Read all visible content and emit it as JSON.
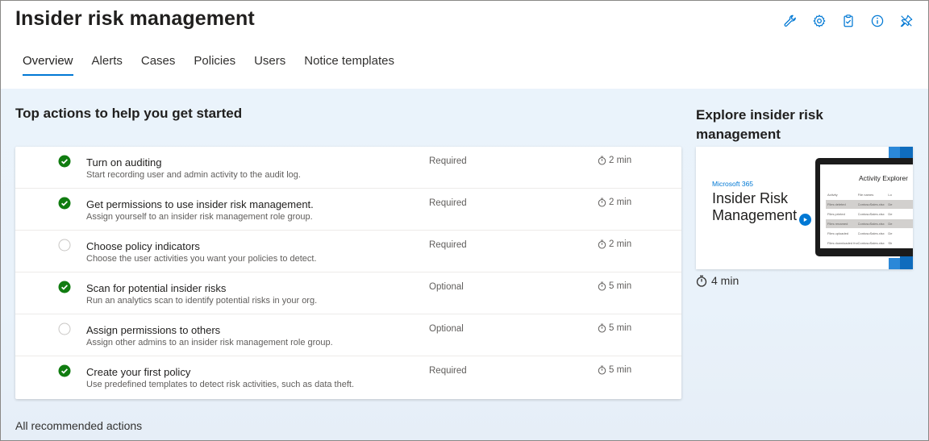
{
  "header": {
    "title": "Insider risk management",
    "icons": [
      "wrench-icon",
      "gear-icon",
      "clipboard-icon",
      "info-icon",
      "pin-icon"
    ]
  },
  "tabs": [
    {
      "label": "Overview",
      "active": true
    },
    {
      "label": "Alerts"
    },
    {
      "label": "Cases"
    },
    {
      "label": "Policies"
    },
    {
      "label": "Users"
    },
    {
      "label": "Notice templates"
    }
  ],
  "top_actions": {
    "title": "Top actions to help you get started",
    "items": [
      {
        "title": "Turn on auditing",
        "description": "Start recording user and admin activity to the audit log.",
        "requirement": "Required",
        "time": "2 min",
        "done": true
      },
      {
        "title": "Get permissions to use insider risk management.",
        "description": "Assign yourself to an insider risk management role group.",
        "requirement": "Required",
        "time": "2 min",
        "done": true
      },
      {
        "title": "Choose policy indicators",
        "description": "Choose the user activities you want your policies to detect.",
        "requirement": "Required",
        "time": "2 min",
        "done": false
      },
      {
        "title": "Scan for potential insider risks",
        "description": "Run an analytics scan to identify potential risks in your org.",
        "requirement": "Optional",
        "time": "5 min",
        "done": true
      },
      {
        "title": "Assign permissions to others",
        "description": "Assign other admins to an insider risk management role group.",
        "requirement": "Optional",
        "time": "5 min",
        "done": false
      },
      {
        "title": "Create your first policy",
        "description": "Use predefined templates to detect risk activities, such as data theft.",
        "requirement": "Required",
        "time": "5 min",
        "done": true
      }
    ],
    "all_link": "All recommended actions"
  },
  "explore": {
    "title": "Explore insider risk management",
    "video": {
      "brand": "Microsoft 365",
      "title_line1": "Insider Risk",
      "title_line2": "Management",
      "screen_title": "Activity Explorer",
      "screen_rows": [
        [
          "Activity",
          "File names",
          "Lo"
        ],
        [
          "Files deleted",
          "ContosoSales.xlsx",
          "De"
        ],
        [
          "Files printed",
          "ContosoSales.xlsx",
          "De"
        ],
        [
          "Files renamed",
          "ContosoSales.xlsx",
          "De"
        ],
        [
          "Files uploaded",
          "ContosoSales.xlsx",
          "De"
        ],
        [
          "Files downloaded from SharePoint",
          "ContosoSales.xlsx",
          "Sh"
        ]
      ]
    },
    "duration": "4 min"
  },
  "colors": {
    "accent": "#0078d4",
    "check": "#107c10"
  }
}
